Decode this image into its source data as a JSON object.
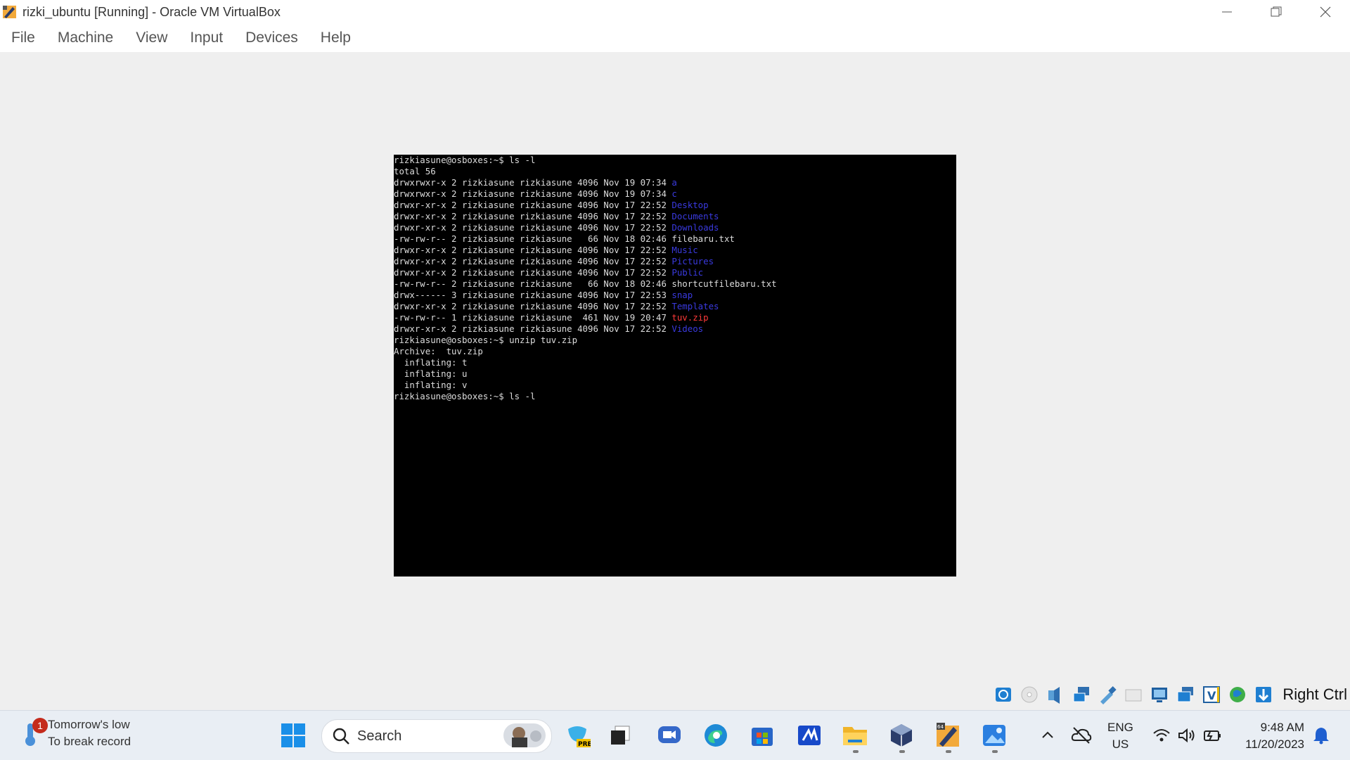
{
  "window": {
    "title": "rizki_ubuntu [Running] - Oracle VM VirtualBox",
    "controls": [
      "minimize-icon",
      "restore-icon",
      "close-icon"
    ]
  },
  "menu": {
    "items": [
      "File",
      "Machine",
      "View",
      "Input",
      "Devices",
      "Help"
    ]
  },
  "terminal": {
    "lines": [
      [
        {
          "t": "rizkiasune@osboxes:~$ ls -l"
        }
      ],
      [
        {
          "t": "total 56"
        }
      ],
      [
        {
          "t": "drwxrwxr-x 2 rizkiasune rizkiasune 4096 Nov 19 07:34 "
        },
        {
          "t": "a",
          "c": "dir"
        }
      ],
      [
        {
          "t": "drwxrwxr-x 2 rizkiasune rizkiasune 4096 Nov 19 07:34 "
        },
        {
          "t": "c",
          "c": "dir"
        }
      ],
      [
        {
          "t": "drwxr-xr-x 2 rizkiasune rizkiasune 4096 Nov 17 22:52 "
        },
        {
          "t": "Desktop",
          "c": "dir"
        }
      ],
      [
        {
          "t": "drwxr-xr-x 2 rizkiasune rizkiasune 4096 Nov 17 22:52 "
        },
        {
          "t": "Documents",
          "c": "dir"
        }
      ],
      [
        {
          "t": "drwxr-xr-x 2 rizkiasune rizkiasune 4096 Nov 17 22:52 "
        },
        {
          "t": "Downloads",
          "c": "dir"
        }
      ],
      [
        {
          "t": "-rw-rw-r-- 2 rizkiasune rizkiasune   66 Nov 18 02:46 filebaru.txt"
        }
      ],
      [
        {
          "t": "drwxr-xr-x 2 rizkiasune rizkiasune 4096 Nov 17 22:52 "
        },
        {
          "t": "Music",
          "c": "dir"
        }
      ],
      [
        {
          "t": "drwxr-xr-x 2 rizkiasune rizkiasune 4096 Nov 17 22:52 "
        },
        {
          "t": "Pictures",
          "c": "dir"
        }
      ],
      [
        {
          "t": "drwxr-xr-x 2 rizkiasune rizkiasune 4096 Nov 17 22:52 "
        },
        {
          "t": "Public",
          "c": "dir"
        }
      ],
      [
        {
          "t": "-rw-rw-r-- 2 rizkiasune rizkiasune   66 Nov 18 02:46 shortcutfilebaru.txt"
        }
      ],
      [
        {
          "t": "drwx------ 3 rizkiasune rizkiasune 4096 Nov 17 22:53 "
        },
        {
          "t": "snap",
          "c": "dir"
        }
      ],
      [
        {
          "t": "drwxr-xr-x 2 rizkiasune rizkiasune 4096 Nov 17 22:52 "
        },
        {
          "t": "Templates",
          "c": "dir"
        }
      ],
      [
        {
          "t": "-rw-rw-r-- 1 rizkiasune rizkiasune  461 Nov 19 20:47 "
        },
        {
          "t": "tuv.zip",
          "c": "zip"
        }
      ],
      [
        {
          "t": "drwxr-xr-x 2 rizkiasune rizkiasune 4096 Nov 17 22:52 "
        },
        {
          "t": "Videos",
          "c": "dir"
        }
      ],
      [
        {
          "t": "rizkiasune@osboxes:~$ unzip tuv.zip"
        }
      ],
      [
        {
          "t": "Archive:  tuv.zip"
        }
      ],
      [
        {
          "t": "  inflating: t"
        }
      ],
      [
        {
          "t": "  inflating: u"
        }
      ],
      [
        {
          "t": "  inflating: v"
        }
      ],
      [
        {
          "t": "rizkiasune@osboxes:~$ ls -l"
        }
      ]
    ]
  },
  "statusbar": {
    "icons": [
      "hard-disk-icon",
      "optical-drive-icon",
      "audio-icon",
      "network-icon",
      "usb-icon",
      "shared-folders-icon",
      "display-icon",
      "recording-icon",
      "guest-additions-icon",
      "cpu-execution-icon",
      "mouse-integration-icon"
    ],
    "host_key": "Right Ctrl"
  },
  "taskbar": {
    "weather_line1": "Tomorrow's low",
    "weather_line2": "To break record",
    "weather_badge": "1",
    "search_label": "Search",
    "lang_line1": "ENG",
    "lang_line2": "US",
    "time": "9:48 AM",
    "date": "11/20/2023",
    "pinned": [
      "start-icon",
      "copilot-preview-icon",
      "task-view-icon",
      "meet-icon",
      "edge-icon",
      "store-icon",
      "vscode-icon",
      "file-explorer-icon",
      "virtualbox-icon",
      "virtualbox-vm-icon",
      "photos-icon"
    ]
  },
  "colors": {
    "terminal_bg": "#000000",
    "terminal_fg": "#dcdcdc",
    "dir": "#3a3adf",
    "archive": "#ff3a3a"
  }
}
